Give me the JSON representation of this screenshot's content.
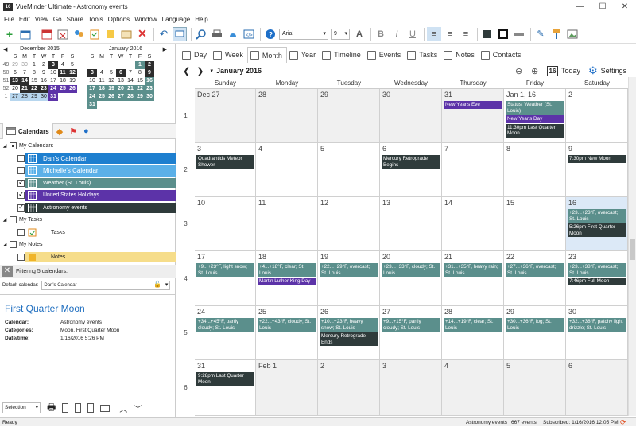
{
  "window": {
    "title": "VueMinder Ultimate - Astronomy events",
    "app_icon": "16"
  },
  "menu": [
    "File",
    "Edit",
    "View",
    "Go",
    "Share",
    "Tools",
    "Options",
    "Window",
    "Language",
    "Help"
  ],
  "toolbar": {
    "font_name": "Arial",
    "font_size": "9",
    "font_color_label": "A"
  },
  "mini_calendars": [
    {
      "title": "December 2015",
      "dow": [
        "S",
        "M",
        "T",
        "W",
        "T",
        "F",
        "S"
      ],
      "weeks": [
        {
          "wk": "49",
          "days": [
            {
              "d": "29",
              "s": "gy"
            },
            {
              "d": "30",
              "s": "gy"
            },
            {
              "d": "1",
              "s": ""
            },
            {
              "d": "2",
              "s": ""
            },
            {
              "d": "3",
              "s": "dk"
            },
            {
              "d": "4",
              "s": ""
            },
            {
              "d": "5",
              "s": ""
            }
          ]
        },
        {
          "wk": "50",
          "days": [
            {
              "d": "6",
              "s": ""
            },
            {
              "d": "7",
              "s": ""
            },
            {
              "d": "8",
              "s": ""
            },
            {
              "d": "9",
              "s": ""
            },
            {
              "d": "10",
              "s": ""
            },
            {
              "d": "11",
              "s": "dk"
            },
            {
              "d": "12",
              "s": "dk"
            }
          ]
        },
        {
          "wk": "51",
          "days": [
            {
              "d": "13",
              "s": "dk"
            },
            {
              "d": "14",
              "s": "dk"
            },
            {
              "d": "15",
              "s": ""
            },
            {
              "d": "16",
              "s": ""
            },
            {
              "d": "17",
              "s": ""
            },
            {
              "d": "18",
              "s": ""
            },
            {
              "d": "19",
              "s": ""
            }
          ]
        },
        {
          "wk": "52",
          "days": [
            {
              "d": "20",
              "s": ""
            },
            {
              "d": "21",
              "s": "dk"
            },
            {
              "d": "22",
              "s": "dk"
            },
            {
              "d": "23",
              "s": "dk"
            },
            {
              "d": "24",
              "s": "pu"
            },
            {
              "d": "25",
              "s": "pu"
            },
            {
              "d": "26",
              "s": "pu"
            }
          ]
        },
        {
          "wk": "1",
          "days": [
            {
              "d": "27",
              "s": "sel"
            },
            {
              "d": "28",
              "s": "sel"
            },
            {
              "d": "29",
              "s": "sel"
            },
            {
              "d": "30",
              "s": "sel"
            },
            {
              "d": "31",
              "s": "pu"
            },
            {
              "d": "",
              "s": ""
            },
            {
              "d": "",
              "s": ""
            }
          ]
        }
      ]
    },
    {
      "title": "January 2016",
      "dow": [
        "S",
        "M",
        "T",
        "W",
        "T",
        "F",
        "S"
      ],
      "weeks": [
        {
          "days": [
            {
              "d": "",
              "s": ""
            },
            {
              "d": "",
              "s": ""
            },
            {
              "d": "",
              "s": ""
            },
            {
              "d": "",
              "s": ""
            },
            {
              "d": "",
              "s": ""
            },
            {
              "d": "1",
              "s": "tl"
            },
            {
              "d": "2",
              "s": "dk"
            }
          ]
        },
        {
          "days": [
            {
              "d": "3",
              "s": "dk"
            },
            {
              "d": "4",
              "s": ""
            },
            {
              "d": "5",
              "s": ""
            },
            {
              "d": "6",
              "s": "dk"
            },
            {
              "d": "7",
              "s": ""
            },
            {
              "d": "8",
              "s": ""
            },
            {
              "d": "9",
              "s": "dk"
            }
          ]
        },
        {
          "days": [
            {
              "d": "10",
              "s": ""
            },
            {
              "d": "11",
              "s": ""
            },
            {
              "d": "12",
              "s": ""
            },
            {
              "d": "13",
              "s": ""
            },
            {
              "d": "14",
              "s": ""
            },
            {
              "d": "15",
              "s": ""
            },
            {
              "d": "16",
              "s": "tl"
            }
          ]
        },
        {
          "days": [
            {
              "d": "17",
              "s": "tl"
            },
            {
              "d": "18",
              "s": "tl"
            },
            {
              "d": "19",
              "s": "tl"
            },
            {
              "d": "20",
              "s": "tl"
            },
            {
              "d": "21",
              "s": "tl"
            },
            {
              "d": "22",
              "s": "tl"
            },
            {
              "d": "23",
              "s": "tl"
            }
          ]
        },
        {
          "days": [
            {
              "d": "24",
              "s": "tl"
            },
            {
              "d": "25",
              "s": "tl"
            },
            {
              "d": "26",
              "s": "tl"
            },
            {
              "d": "27",
              "s": "tl"
            },
            {
              "d": "28",
              "s": "tl"
            },
            {
              "d": "29",
              "s": "tl"
            },
            {
              "d": "30",
              "s": "tl"
            }
          ]
        },
        {
          "days": [
            {
              "d": "31",
              "s": "tl"
            },
            {
              "d": "",
              "s": ""
            },
            {
              "d": "",
              "s": ""
            },
            {
              "d": "",
              "s": ""
            },
            {
              "d": "",
              "s": ""
            },
            {
              "d": "",
              "s": ""
            },
            {
              "d": "",
              "s": ""
            }
          ]
        }
      ]
    }
  ],
  "sidebar_tab": "Calendars",
  "tree": {
    "my_calendars": "My Calendars",
    "calendars": [
      {
        "name": "Dan's Calendar",
        "color": "#1e7fcf",
        "text": "#fff",
        "checked": false
      },
      {
        "name": "Michelle's Calendar",
        "color": "#5bb0e8",
        "text": "#fff",
        "checked": false
      },
      {
        "name": "Weather (St. Louis)",
        "color": "#5b8f8c",
        "text": "#fff",
        "checked": true
      },
      {
        "name": "United States Holidays",
        "color": "#5c33a8",
        "text": "#fff",
        "checked": true
      },
      {
        "name": "Astronomy events",
        "color": "#2f3b3b",
        "text": "#fff",
        "checked": true
      }
    ],
    "my_tasks": "My Tasks",
    "tasks": "Tasks",
    "my_notes": "My Notes",
    "notes": "Notes",
    "notes_color": "#f6dd8a"
  },
  "filter_text": "Filtering 5 calendars.",
  "default_calendar": {
    "label": "Default calendar:",
    "value": "Dan's Calendar"
  },
  "details": {
    "title": "First Quarter Moon",
    "rows": [
      {
        "k": "Calendar:",
        "v": "Astronomy events"
      },
      {
        "k": "Categories:",
        "v": "Moon, First Quarter Moon"
      },
      {
        "k": "Date/time:",
        "v": "1/16/2016 5:26 PM"
      }
    ]
  },
  "left_bottom": {
    "selection": "Selection"
  },
  "view_tabs": [
    "Day",
    "Week",
    "Month",
    "Year",
    "Timeline",
    "Events",
    "Tasks",
    "Notes",
    "Contacts"
  ],
  "active_view": "Month",
  "nav": {
    "month": "January 2016",
    "today": "Today",
    "settings": "Settings",
    "today_icon": "16"
  },
  "day_headers": [
    "Sunday",
    "Monday",
    "Tuesday",
    "Wednesday",
    "Thursday",
    "Friday",
    "Saturday"
  ],
  "weeks": [
    {
      "num": "1",
      "days": [
        {
          "d": "Dec 27",
          "grey": true,
          "ev": []
        },
        {
          "d": "28",
          "grey": true,
          "ev": []
        },
        {
          "d": "29",
          "grey": true,
          "ev": []
        },
        {
          "d": "30",
          "grey": true,
          "ev": []
        },
        {
          "d": "31",
          "grey": true,
          "ev": [
            {
              "t": "New Year's Eve",
              "c": "purple"
            }
          ]
        },
        {
          "d": "Jan 1, 16",
          "ev": [
            {
              "t": "Status: Weather (St. Louis)",
              "c": "teal"
            },
            {
              "t": "New Year's Day",
              "c": "purple"
            },
            {
              "t": "11:30pm Last Quarter Moon",
              "c": "dark"
            }
          ]
        },
        {
          "d": "2",
          "ev": []
        }
      ]
    },
    {
      "num": "2",
      "days": [
        {
          "d": "3",
          "ev": [
            {
              "t": "Quadrantids Meteor Shower",
              "c": "dark"
            }
          ]
        },
        {
          "d": "4",
          "ev": []
        },
        {
          "d": "5",
          "ev": []
        },
        {
          "d": "6",
          "ev": [
            {
              "t": "Mercury Retrograde Begins",
              "c": "dark"
            }
          ]
        },
        {
          "d": "7",
          "ev": []
        },
        {
          "d": "8",
          "ev": []
        },
        {
          "d": "9",
          "ev": [
            {
              "t": "7:30pm New Moon",
              "c": "dark"
            }
          ]
        }
      ]
    },
    {
      "num": "3",
      "days": [
        {
          "d": "10",
          "ev": []
        },
        {
          "d": "11",
          "ev": []
        },
        {
          "d": "12",
          "ev": []
        },
        {
          "d": "13",
          "ev": []
        },
        {
          "d": "14",
          "ev": []
        },
        {
          "d": "15",
          "ev": []
        },
        {
          "d": "16",
          "today": true,
          "ev": [
            {
              "t": "+23...+23°F, overcast; St. Louis",
              "c": "teal"
            },
            {
              "t": "5:26pm First Quarter Moon",
              "c": "dark"
            }
          ]
        }
      ]
    },
    {
      "num": "4",
      "days": [
        {
          "d": "17",
          "ev": [
            {
              "t": "+9...+23°F, light snow; St. Louis",
              "c": "teal"
            }
          ]
        },
        {
          "d": "18",
          "ev": [
            {
              "t": "+4...+18°F, clear; St. Louis",
              "c": "teal"
            },
            {
              "t": "Martin Luther King Day",
              "c": "purple"
            }
          ]
        },
        {
          "d": "19",
          "ev": [
            {
              "t": "+22...+29°F, overcast; St. Louis",
              "c": "teal"
            }
          ]
        },
        {
          "d": "20",
          "ev": [
            {
              "t": "+23...+33°F, cloudy; St. Louis",
              "c": "teal"
            }
          ]
        },
        {
          "d": "21",
          "ev": [
            {
              "t": "+31...+35°F, heavy rain; St. Louis",
              "c": "teal"
            }
          ]
        },
        {
          "d": "22",
          "ev": [
            {
              "t": "+27...+36°F, overcast; St. Louis",
              "c": "teal"
            }
          ]
        },
        {
          "d": "23",
          "ev": [
            {
              "t": "+23...+38°F, overcast; St. Louis",
              "c": "teal"
            },
            {
              "t": "7:46pm Full Moon",
              "c": "dark"
            }
          ]
        }
      ]
    },
    {
      "num": "5",
      "days": [
        {
          "d": "24",
          "ev": [
            {
              "t": "+34...+45°F, partly cloudy; St. Louis",
              "c": "teal"
            }
          ]
        },
        {
          "d": "25",
          "ev": [
            {
              "t": "+22...+43°F, cloudy; St. Louis",
              "c": "teal"
            }
          ]
        },
        {
          "d": "26",
          "ev": [
            {
              "t": "+10...+23°F, heavy snow; St. Louis",
              "c": "teal"
            },
            {
              "t": "Mercury Retrograde Ends",
              "c": "dark"
            }
          ]
        },
        {
          "d": "27",
          "ev": [
            {
              "t": "+9...+15°F, partly cloudy; St. Louis",
              "c": "teal"
            }
          ]
        },
        {
          "d": "28",
          "ev": [
            {
              "t": "+14...+19°F, clear; St. Louis",
              "c": "teal"
            }
          ]
        },
        {
          "d": "29",
          "ev": [
            {
              "t": "+30...+36°F, fog; St. Louis",
              "c": "teal"
            }
          ]
        },
        {
          "d": "30",
          "ev": [
            {
              "t": "+32...+38°F, patchy light drizzle; St. Louis",
              "c": "teal"
            }
          ]
        }
      ]
    },
    {
      "num": "6",
      "days": [
        {
          "d": "31",
          "ev": [
            {
              "t": "9:28pm Last Quarter Moon",
              "c": "dark"
            }
          ]
        },
        {
          "d": "Feb 1",
          "grey": true,
          "ev": []
        },
        {
          "d": "2",
          "grey": true,
          "ev": []
        },
        {
          "d": "3",
          "grey": true,
          "ev": []
        },
        {
          "d": "4",
          "grey": true,
          "ev": []
        },
        {
          "d": "5",
          "grey": true,
          "ev": []
        },
        {
          "d": "6",
          "grey": true,
          "ev": []
        }
      ]
    }
  ],
  "status": {
    "ready": "Ready",
    "calendar": "Astronomy events",
    "count": "667 events",
    "subscribed": "Subscribed: 1/16/2016 12:05 PM"
  }
}
